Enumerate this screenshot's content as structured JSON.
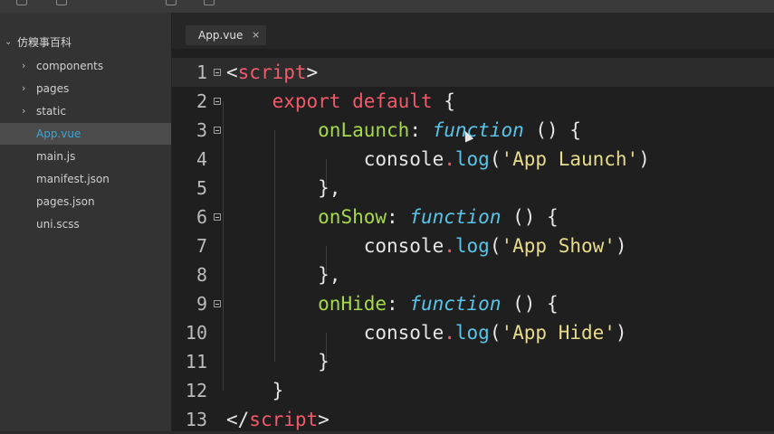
{
  "sidebar": {
    "project": "仿糗事百科",
    "items": [
      {
        "label": "components",
        "folder": true
      },
      {
        "label": "pages",
        "folder": true
      },
      {
        "label": "static",
        "folder": true
      },
      {
        "label": "App.vue",
        "folder": false,
        "selected": true
      },
      {
        "label": "main.js",
        "folder": false
      },
      {
        "label": "manifest.json",
        "folder": false
      },
      {
        "label": "pages.json",
        "folder": false
      },
      {
        "label": "uni.scss",
        "folder": false
      }
    ]
  },
  "tabs": [
    {
      "label": "App.vue",
      "close": "×"
    }
  ],
  "editor": {
    "lines": [
      {
        "num": "1",
        "fold": true,
        "current": true,
        "tokens": [
          [
            "tok-punct",
            "<"
          ],
          [
            "tok-tag",
            "script"
          ],
          [
            "tok-punct",
            ">"
          ]
        ]
      },
      {
        "num": "2",
        "fold": true,
        "tokens": [
          [
            "",
            "    "
          ],
          [
            "tok-kw",
            "export"
          ],
          [
            "",
            " "
          ],
          [
            "tok-kw",
            "default"
          ],
          [
            "tok-punct",
            " {"
          ]
        ]
      },
      {
        "num": "3",
        "fold": true,
        "tokens": [
          [
            "",
            "        "
          ],
          [
            "tok-prop",
            "onLaunch"
          ],
          [
            "tok-punct",
            ": "
          ],
          [
            "tok-fn",
            "function"
          ],
          [
            "tok-punct",
            " () {"
          ]
        ]
      },
      {
        "num": "4",
        "fold": false,
        "tokens": [
          [
            "",
            "            "
          ],
          [
            "tok-punct",
            "console"
          ],
          [
            "tok-dot",
            "."
          ],
          [
            "tok-method",
            "log"
          ],
          [
            "tok-punct",
            "("
          ],
          [
            "tok-str",
            "'App Launch'"
          ],
          [
            "tok-punct",
            ")"
          ]
        ]
      },
      {
        "num": "5",
        "fold": false,
        "tokens": [
          [
            "",
            "        "
          ],
          [
            "tok-punct",
            "},"
          ]
        ]
      },
      {
        "num": "6",
        "fold": true,
        "tokens": [
          [
            "",
            "        "
          ],
          [
            "tok-prop",
            "onShow"
          ],
          [
            "tok-punct",
            ": "
          ],
          [
            "tok-fn",
            "function"
          ],
          [
            "tok-punct",
            " () {"
          ]
        ]
      },
      {
        "num": "7",
        "fold": false,
        "tokens": [
          [
            "",
            "            "
          ],
          [
            "tok-punct",
            "console"
          ],
          [
            "tok-dot",
            "."
          ],
          [
            "tok-method",
            "log"
          ],
          [
            "tok-punct",
            "("
          ],
          [
            "tok-str",
            "'App Show'"
          ],
          [
            "tok-punct",
            ")"
          ]
        ]
      },
      {
        "num": "8",
        "fold": false,
        "tokens": [
          [
            "",
            "        "
          ],
          [
            "tok-punct",
            "},"
          ]
        ]
      },
      {
        "num": "9",
        "fold": true,
        "tokens": [
          [
            "",
            "        "
          ],
          [
            "tok-prop",
            "onHide"
          ],
          [
            "tok-punct",
            ": "
          ],
          [
            "tok-fn",
            "function"
          ],
          [
            "tok-punct",
            " () {"
          ]
        ]
      },
      {
        "num": "10",
        "fold": false,
        "tokens": [
          [
            "",
            "            "
          ],
          [
            "tok-punct",
            "console"
          ],
          [
            "tok-dot",
            "."
          ],
          [
            "tok-method",
            "log"
          ],
          [
            "tok-punct",
            "("
          ],
          [
            "tok-str",
            "'App Hide'"
          ],
          [
            "tok-punct",
            ")"
          ]
        ]
      },
      {
        "num": "11",
        "fold": false,
        "tokens": [
          [
            "",
            "        "
          ],
          [
            "tok-punct",
            "}"
          ]
        ]
      },
      {
        "num": "12",
        "fold": false,
        "tokens": [
          [
            "",
            "    "
          ],
          [
            "tok-punct",
            "}"
          ]
        ]
      },
      {
        "num": "13",
        "fold": false,
        "tokens": [
          [
            "tok-punct",
            "</"
          ],
          [
            "tok-tag",
            "script"
          ],
          [
            "tok-punct",
            ">"
          ]
        ]
      }
    ]
  },
  "colors": {
    "sidebar_bg": "#333333",
    "editor_bg": "#1f1f1f",
    "selected_file": "#3aa6d8",
    "tag": "#f25a6a",
    "property": "#a6d94a",
    "function_keyword": "#58c5e8",
    "string": "#e8dc8a"
  }
}
